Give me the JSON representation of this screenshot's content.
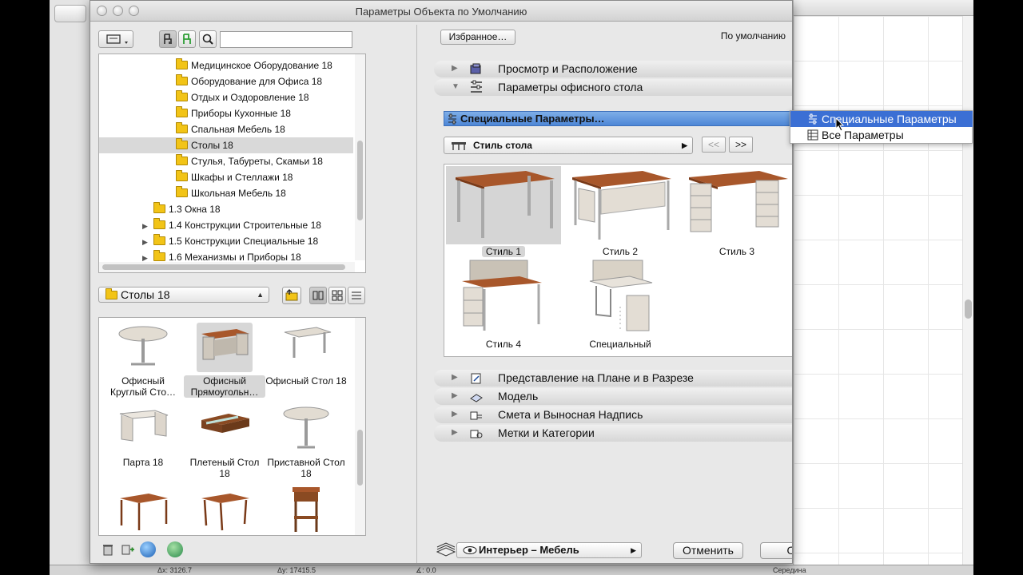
{
  "dialog": {
    "title": "Параметры Объекта по Умолчанию"
  },
  "library": {
    "search_placeholder": "",
    "tree": [
      {
        "label": "Медицинское Оборудование 18",
        "level": 2,
        "selected": false,
        "expandable": false
      },
      {
        "label": "Оборудование для Офиса 18",
        "level": 2,
        "selected": false,
        "expandable": false
      },
      {
        "label": "Отдых и Оздоровление 18",
        "level": 2,
        "selected": false,
        "expandable": false
      },
      {
        "label": "Приборы Кухонные 18",
        "level": 2,
        "selected": false,
        "expandable": false
      },
      {
        "label": "Спальная Мебель 18",
        "level": 2,
        "selected": false,
        "expandable": false
      },
      {
        "label": "Столы 18",
        "level": 2,
        "selected": true,
        "expandable": false
      },
      {
        "label": "Стулья, Табуреты, Скамьи 18",
        "level": 2,
        "selected": false,
        "expandable": false
      },
      {
        "label": "Шкафы и Стеллажи 18",
        "level": 2,
        "selected": false,
        "expandable": false
      },
      {
        "label": "Школьная Мебель 18",
        "level": 2,
        "selected": false,
        "expandable": false
      },
      {
        "label": "1.3 Окна 18",
        "level": 1,
        "selected": false,
        "expandable": false
      },
      {
        "label": "1.4 Конструкции Строительные 18",
        "level": 1,
        "selected": false,
        "expandable": true
      },
      {
        "label": "1.5 Конструкции Специальные 18",
        "level": 1,
        "selected": false,
        "expandable": true
      },
      {
        "label": "1.6 Механизмы и Приборы 18",
        "level": 1,
        "selected": false,
        "expandable": true
      }
    ],
    "current_folder": "Столы 18",
    "gallery": [
      {
        "label": "Офисный Круглый Сто…",
        "selected": false,
        "shape": "round"
      },
      {
        "label": "Офисный Прямоугольн…",
        "selected": true,
        "shape": "desk"
      },
      {
        "label": "Офисный Стол 18",
        "selected": false,
        "shape": "office"
      },
      {
        "label": "Парта 18",
        "selected": false,
        "shape": "school"
      },
      {
        "label": "Плетеный Стол 18",
        "selected": false,
        "shape": "wicker"
      },
      {
        "label": "Приставной Стол 18",
        "selected": false,
        "shape": "side"
      },
      {
        "label": "",
        "selected": false,
        "shape": "wood1"
      },
      {
        "label": "",
        "selected": false,
        "shape": "wood2"
      },
      {
        "label": "",
        "selected": false,
        "shape": "night"
      }
    ]
  },
  "params": {
    "favorites_label": "Избранное…",
    "default_label": "По умолчанию",
    "sections_top": [
      {
        "label": "Просмотр и Расположение",
        "expanded": false
      },
      {
        "label": "Параметры офисного стола",
        "expanded": true
      }
    ],
    "special_params_label": "Специальные Параметры…",
    "popup": [
      {
        "label": "Специальные Параметры",
        "highlighted": true
      },
      {
        "label": "Все Параметры",
        "highlighted": false
      }
    ],
    "style_select": "Стиль стола",
    "prev_label": "<<",
    "next_label": ">>",
    "styles": [
      {
        "label": "Стиль 1",
        "selected": true
      },
      {
        "label": "Стиль 2",
        "selected": false
      },
      {
        "label": "Стиль 3",
        "selected": false
      },
      {
        "label": "Стиль 4",
        "selected": false
      },
      {
        "label": "Специальный",
        "selected": false
      }
    ],
    "sections_bottom": [
      {
        "label": "Представление на Плане и в Разрезе"
      },
      {
        "label": "Модель"
      },
      {
        "label": "Смета и Выносная Надпись"
      },
      {
        "label": "Метки и Категории"
      }
    ],
    "layer_select": "Интерьер – Мебель",
    "cancel_label": "Отменить",
    "ok_label": "ОК"
  },
  "statusbar": {
    "items": [
      "Δx: 3126.7",
      "Δy: 17415.5",
      "∡: 0.0",
      "Середина"
    ]
  },
  "colors": {
    "highlight": "#3b6fd4",
    "folder": "#f2c417",
    "wood": "#a8572b"
  }
}
